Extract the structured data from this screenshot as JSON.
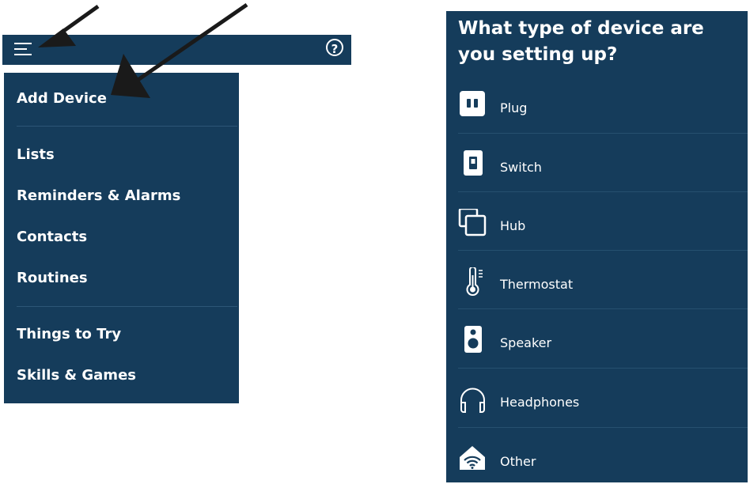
{
  "menu": {
    "items": [
      {
        "label": "Add Device"
      },
      {
        "label": "Lists"
      },
      {
        "label": "Reminders & Alarms"
      },
      {
        "label": "Contacts"
      },
      {
        "label": "Routines"
      },
      {
        "label": "Things to Try"
      },
      {
        "label": "Skills & Games"
      }
    ]
  },
  "topbar": {
    "menu_icon": "hamburger-icon",
    "help_icon": "help-icon",
    "help_glyph": "?"
  },
  "device_panel": {
    "title": "What type of device are you setting up?",
    "devices": [
      {
        "label": "Plug",
        "icon": "plug-icon"
      },
      {
        "label": "Switch",
        "icon": "switch-icon"
      },
      {
        "label": "Hub",
        "icon": "hub-icon"
      },
      {
        "label": "Thermostat",
        "icon": "thermostat-icon"
      },
      {
        "label": "Speaker",
        "icon": "speaker-icon"
      },
      {
        "label": "Headphones",
        "icon": "headphones-icon"
      },
      {
        "label": "Other",
        "icon": "wifi-icon"
      }
    ]
  },
  "colors": {
    "panel_bg": "#153c5b",
    "text": "#ffffff",
    "divider": "#2d5677",
    "arrow": "#1a1a1a"
  }
}
